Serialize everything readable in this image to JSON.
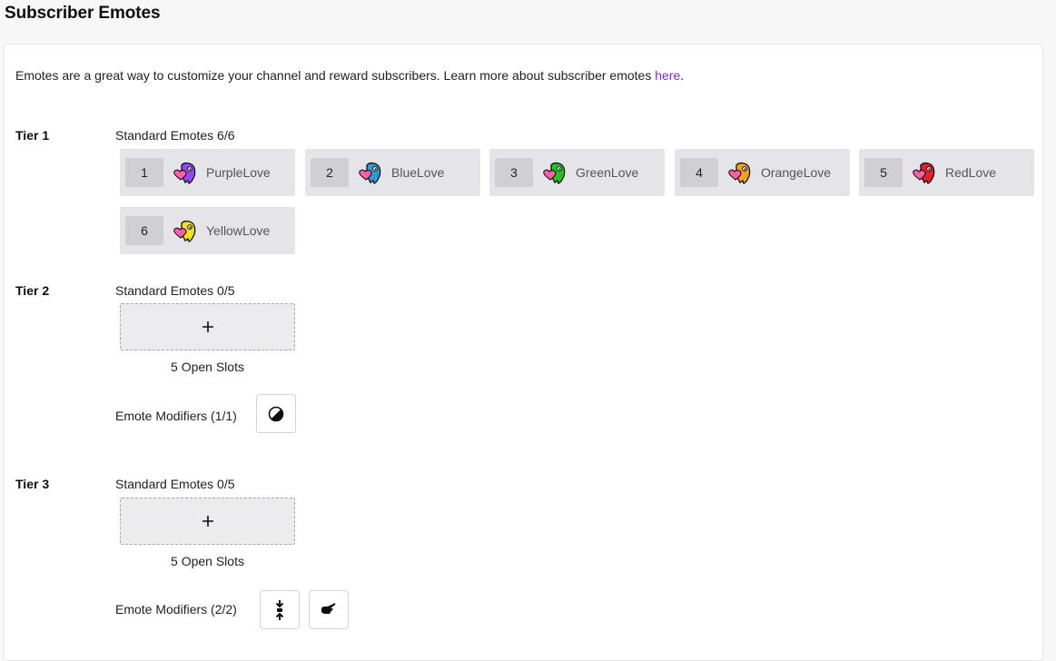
{
  "page": {
    "title": "Subscriber Emotes"
  },
  "intro": {
    "text": "Emotes are a great way to customize your channel and reward subscribers. Learn more about subscriber emotes ",
    "link": "here",
    "suffix": "."
  },
  "tiers": [
    {
      "label": "Tier 1",
      "standard_label": "Standard Emotes 6/6",
      "emotes": [
        {
          "slot": "1",
          "name": "PurpleLove",
          "color": "#9147ff"
        },
        {
          "slot": "2",
          "name": "BlueLove",
          "color": "#2e9ad6"
        },
        {
          "slot": "3",
          "name": "GreenLove",
          "color": "#1ec61e"
        },
        {
          "slot": "4",
          "name": "OrangeLove",
          "color": "#f4a020"
        },
        {
          "slot": "5",
          "name": "RedLove",
          "color": "#eb1c2e"
        },
        {
          "slot": "6",
          "name": "YellowLove",
          "color": "#f2e21a"
        }
      ]
    },
    {
      "label": "Tier 2",
      "standard_label": "Standard Emotes 0/5",
      "open_slots": "5 Open Slots",
      "add_icon": "plus-icon",
      "modifiers_label": "Emote Modifiers (1/1)",
      "modifiers": [
        {
          "icon": "half-circle-icon"
        }
      ]
    },
    {
      "label": "Tier 3",
      "standard_label": "Standard Emotes 0/5",
      "open_slots": "5 Open Slots",
      "add_icon": "plus-icon",
      "modifiers_label": "Emote Modifiers (2/2)",
      "modifiers": [
        {
          "icon": "squish-icon"
        },
        {
          "icon": "pointing-hand-icon"
        }
      ]
    }
  ],
  "colors": {
    "accent": "#772ce8",
    "heart": "#ff5fa8"
  }
}
